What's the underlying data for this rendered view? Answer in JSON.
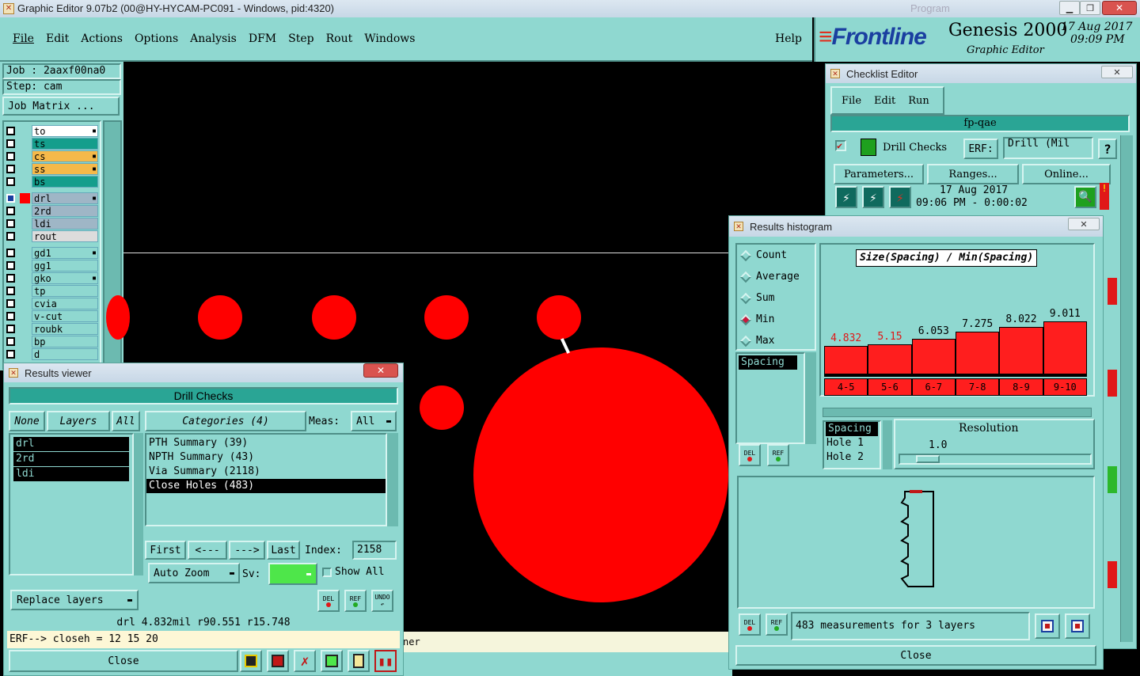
{
  "titlebar": {
    "title": "Graphic Editor 9.07b2 (00@HY-HYCAM-PC091 - Windows, pid:4320)",
    "ghost": "Program"
  },
  "menu": {
    "items": [
      "File",
      "Edit",
      "Actions",
      "Options",
      "Analysis",
      "DFM",
      "Step",
      "Rout",
      "Windows"
    ],
    "help": "Help"
  },
  "brand": {
    "logo": "Frontline",
    "product": "Genesis 2000",
    "subtitle": "Graphic Editor",
    "date": "17 Aug 2017",
    "time": "09:09 PM"
  },
  "job": {
    "job": "Job : 2aaxf00na0",
    "step": "Step: cam",
    "matrix_btn": "Job Matrix ..."
  },
  "layers": [
    {
      "name": "to",
      "color": "#ffffff",
      "mark": true
    },
    {
      "name": "ts",
      "color": "#149e8c",
      "mark": false
    },
    {
      "name": "cs",
      "color": "#f5b94a",
      "mark": true
    },
    {
      "name": "ss",
      "color": "#f5b94a",
      "mark": true
    },
    {
      "name": "bs",
      "color": "#149e8c",
      "mark": false
    },
    {
      "name": "drl",
      "color": "#9fb6c6",
      "mark": true,
      "active": true
    },
    {
      "name": "2rd",
      "color": "#9fb6c6",
      "mark": false
    },
    {
      "name": "ldi",
      "color": "#9fb6c6",
      "mark": false
    },
    {
      "name": "rout",
      "color": "#dcdcdc",
      "mark": false
    },
    {
      "name": "gd1",
      "color": "#8fd8d0",
      "mark": true
    },
    {
      "name": "gg1",
      "color": "#8fd8d0",
      "mark": false
    },
    {
      "name": "gko",
      "color": "#8fd8d0",
      "mark": true
    },
    {
      "name": "tp",
      "color": "#8fd8d0",
      "mark": false
    },
    {
      "name": "cvia",
      "color": "#8fd8d0",
      "mark": false
    },
    {
      "name": "v-cut",
      "color": "#8fd8d0",
      "mark": false
    },
    {
      "name": "roubk",
      "color": "#8fd8d0",
      "mark": false
    },
    {
      "name": "bp",
      "color": "#8fd8d0",
      "mark": false
    },
    {
      "name": "d",
      "color": "#8fd8d0",
      "mark": false
    }
  ],
  "canvas": {
    "status_fragment": "ner"
  },
  "results_viewer": {
    "title": "Results viewer",
    "header": "Drill Checks",
    "none_btn": "None",
    "layers_btn": "Layers",
    "all_btn": "All",
    "categories_btn": "Categories (4)",
    "meas_label": "Meas:",
    "meas_value": "All",
    "layer_list": [
      "drl",
      "2rd",
      "ldi"
    ],
    "categories": [
      "PTH Summary (39)",
      "NPTH Summary (43)",
      "Via Summary (2118)",
      "Close Holes (483)"
    ],
    "selected_category": 3,
    "nav": {
      "first": "First",
      "prev": "<---",
      "next": "--->",
      "last": "Last",
      "index_label": "Index:",
      "index_value": "2158"
    },
    "auto_zoom": "Auto Zoom",
    "sv_label": "Sv:",
    "show_all": "Show All",
    "replace_layers": "Replace layers",
    "info": "drl 4.832mil  r90.551  r15.748",
    "erf": "ERF--> closeh = 12 15 20",
    "close": "Close",
    "icons": {
      "del": "DEL",
      "ref": "REF",
      "undo": "UNDO"
    }
  },
  "checklist": {
    "title": "Checklist Editor",
    "menu": [
      "File",
      "Edit",
      "Run"
    ],
    "name": "fp-qae",
    "check_name": "Drill Checks",
    "erf_label": "ERF:",
    "erf_value": "Drill (Mil",
    "help": "?",
    "parameters": "Parameters...",
    "ranges": "Ranges...",
    "online": "Online...",
    "run_date": "17 Aug 2017",
    "run_time": "09:06 PM - 0:00:02"
  },
  "histogram": {
    "title": "Results histogram",
    "modes": [
      "Count",
      "Average",
      "Sum",
      "Min",
      "Max"
    ],
    "selected_mode": 3,
    "chart_title": "Size(Spacing) / Min(Spacing)",
    "measure_list": [
      "Spacing"
    ],
    "resolution_label": "Resolution",
    "resolution_value": "1.0",
    "spacing_list": [
      "Spacing",
      "Hole 1",
      "Hole 2"
    ],
    "summary": "483 measurements for 3 layers",
    "close": "Close"
  },
  "chart_data": {
    "type": "bar",
    "title": "Size(Spacing) / Min(Spacing)",
    "categories": [
      "4-5",
      "5-6",
      "6-7",
      "7-8",
      "8-9",
      "9-10"
    ],
    "values": [
      4.832,
      5.15,
      6.053,
      7.275,
      8.022,
      9.011
    ],
    "value_colors": [
      "#e01818",
      "#e01818",
      "#000000",
      "#000000",
      "#000000",
      "#000000"
    ],
    "bar_color": "#ff1e1e",
    "ylim": [
      0,
      10
    ]
  },
  "colors": {
    "panel": "#8fd8d0",
    "feature": "#ff0000",
    "selected": "#000000"
  }
}
